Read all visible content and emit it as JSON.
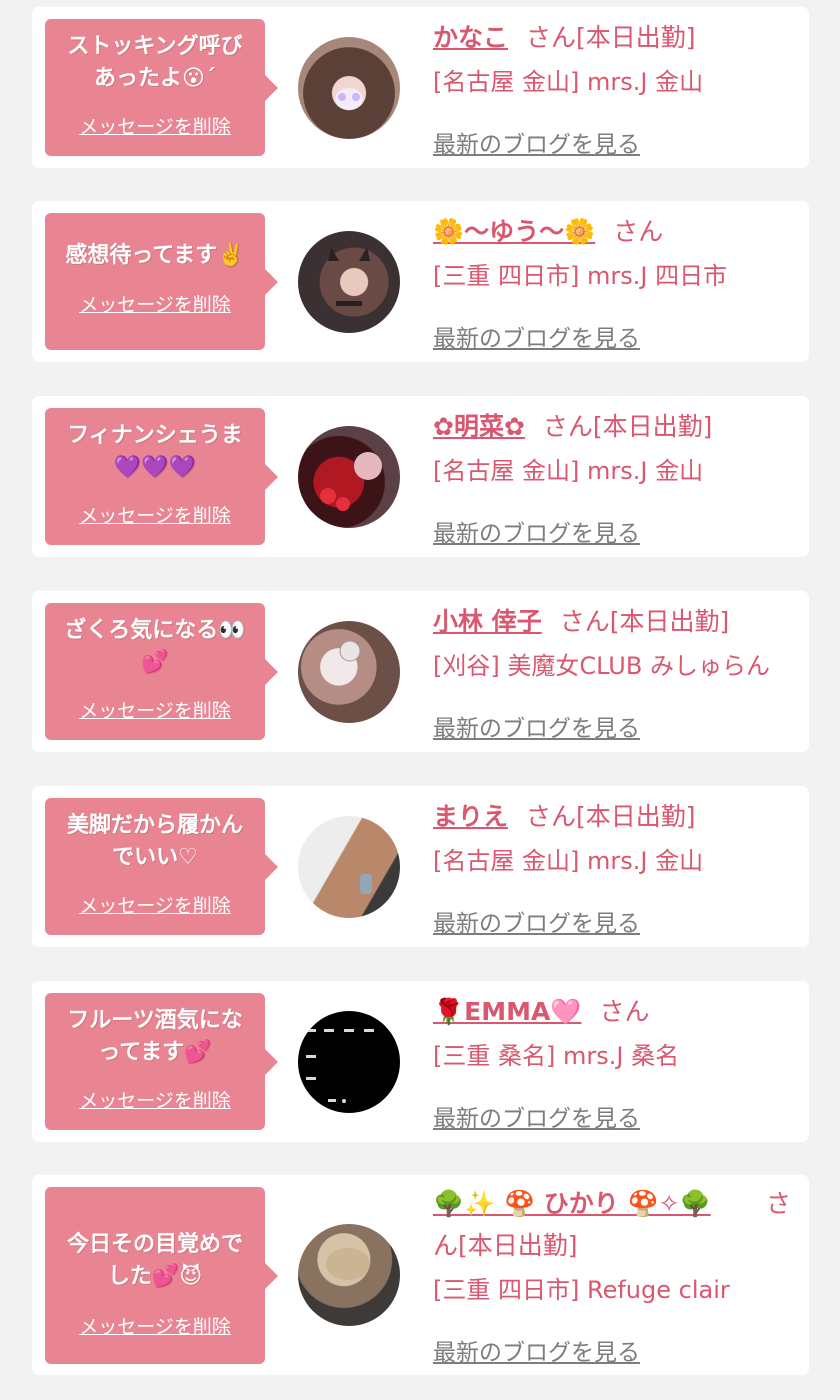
{
  "colors": {
    "bubble": "#e98592",
    "accent": "#d9576f",
    "background": "#f2f2f2",
    "link_gray": "#7d7d7d"
  },
  "cards": [
    {
      "message_line1": "ストッキング呼び",
      "message_line2": "あったよ😮´",
      "delete_label": "メッセージを削除",
      "name": "かなこ",
      "honorific": "さん[本日出勤]",
      "shop": "[名古屋 金山] mrs.J 金山",
      "blog_link": "最新のブログを見る",
      "avatar_icon": "woman-portrait-icon"
    },
    {
      "message_line1": "感想待ってます✌️",
      "message_line2": "",
      "delete_label": "メッセージを削除",
      "name": "🌼〜ゆう〜🌼",
      "honorific": "さん",
      "shop": "[三重 四日市] mrs.J 四日市",
      "blog_link": "最新のブログを見る",
      "avatar_icon": "woman-portrait-icon"
    },
    {
      "message_line1": "フィナンシェうま",
      "message_line2": "💜💜💜",
      "delete_label": "メッセージを削除",
      "name": "✿明菜✿",
      "honorific": "さん[本日出勤]",
      "shop": "[名古屋 金山] mrs.J 金山",
      "blog_link": "最新のブログを見る",
      "avatar_icon": "woman-portrait-icon"
    },
    {
      "message_line1": "ざくろ気になる👀",
      "message_line2": "💕",
      "delete_label": "メッセージを削除",
      "name": "小林 倖子",
      "honorific": "さん[本日出勤]",
      "shop": "[刈谷] 美魔女CLUB みしゅらん",
      "blog_link": "最新のブログを見る",
      "avatar_icon": "woman-portrait-icon"
    },
    {
      "message_line1": "美脚だから履かん",
      "message_line2": "でいい♡",
      "delete_label": "メッセージを削除",
      "name": "まりえ",
      "honorific": "さん[本日出勤]",
      "shop": "[名古屋 金山] mrs.J 金山",
      "blog_link": "最新のブログを見る",
      "avatar_icon": "woman-portrait-icon"
    },
    {
      "message_line1": "フルーツ酒気にな",
      "message_line2": "ってます💕",
      "delete_label": "メッセージを削除",
      "name": "🌹EMMA🩷",
      "honorific": "さん",
      "shop": "[三重 桑名] mrs.J 桑名",
      "blog_link": "最新のブログを見る",
      "avatar_icon": "text-image-icon"
    },
    {
      "message_line1": "今日その目覚めで",
      "message_line2": "した💕😈",
      "delete_label": "メッセージを削除",
      "name": "🌳✨ 🍄 ひかり 🍄✧🌳",
      "honorific": "さ",
      "honorific2": "ん[本日出勤]",
      "shop": "[三重 四日市] Refuge clair",
      "blog_link": "最新のブログを見る",
      "avatar_icon": "hair-portrait-icon"
    }
  ]
}
